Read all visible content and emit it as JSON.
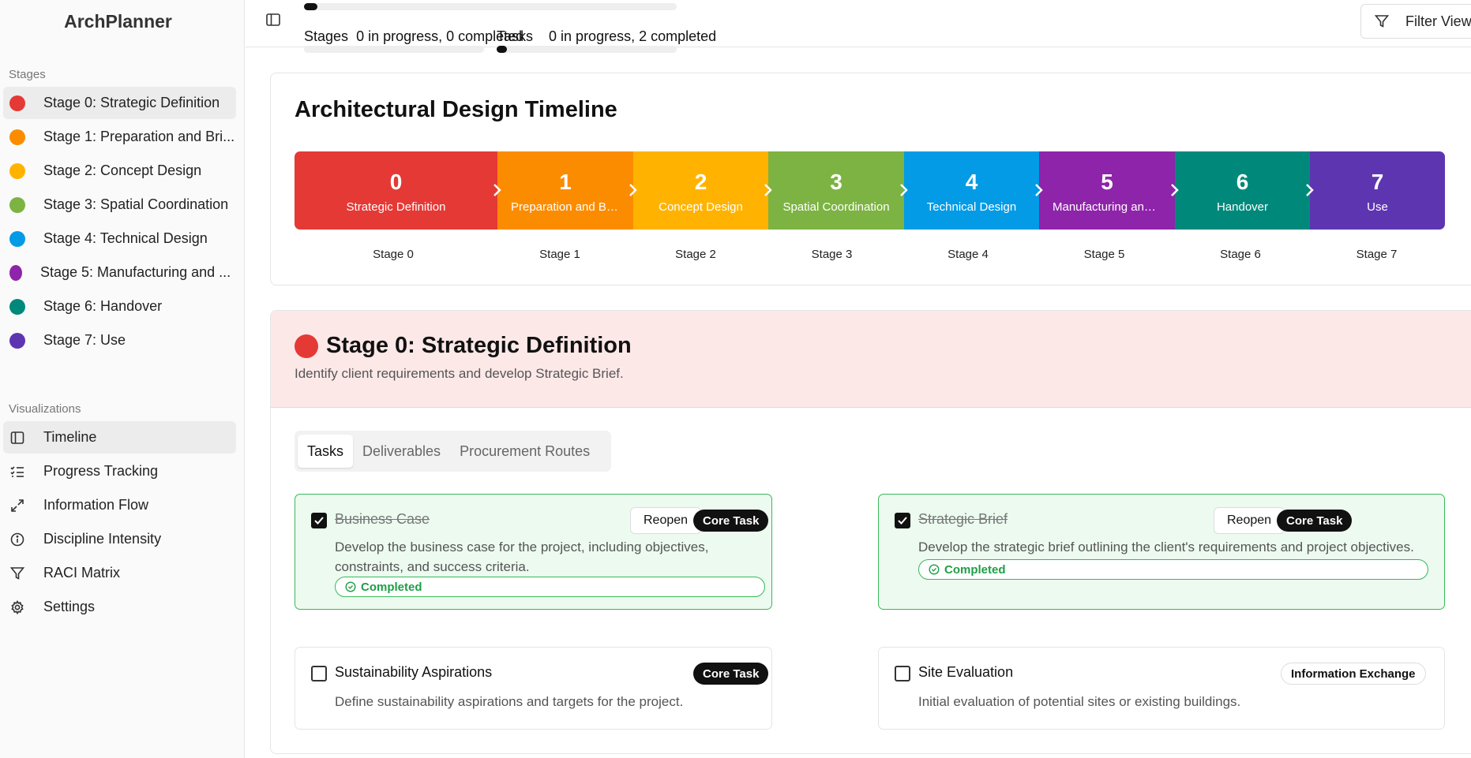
{
  "app": {
    "title": "ArchPlanner"
  },
  "sidebar": {
    "stages_label": "Stages",
    "stages": [
      {
        "label": "Stage 0: Strategic Definition",
        "color": "#e53935",
        "active": true
      },
      {
        "label": "Stage 1: Preparation and Bri...",
        "color": "#fb8c00"
      },
      {
        "label": "Stage 2: Concept Design",
        "color": "#ffb300"
      },
      {
        "label": "Stage 3: Spatial Coordination",
        "color": "#7cb342"
      },
      {
        "label": "Stage 4: Technical Design",
        "color": "#039be5"
      },
      {
        "label": "Stage 5: Manufacturing and ...",
        "color": "#8e24aa"
      },
      {
        "label": "Stage 6: Handover",
        "color": "#00897b"
      },
      {
        "label": "Stage 7: Use",
        "color": "#5e35b1"
      }
    ],
    "viz_label": "Visualizations",
    "visualizations": [
      {
        "label": "Timeline",
        "icon": "panel-icon",
        "active": true
      },
      {
        "label": "Progress Tracking",
        "icon": "list-checks-icon"
      },
      {
        "label": "Information Flow",
        "icon": "expand-arrows-icon"
      },
      {
        "label": "Discipline Intensity",
        "icon": "info-circle-icon"
      },
      {
        "label": "RACI Matrix",
        "icon": "filter-icon"
      },
      {
        "label": "Settings",
        "icon": "gear-icon"
      }
    ]
  },
  "topbar": {
    "stages_label": "Stages",
    "stages_status": "0 in progress, 0 completed",
    "stages_progress": 0.02,
    "tasks_label": "Tasks",
    "tasks_status": "0 in progress, 2 completed",
    "tasks_progress": 0.02,
    "filter_label": "Filter View"
  },
  "timeline": {
    "title": "Architectural Design Timeline",
    "stages": [
      {
        "num": "0",
        "name": "Strategic Definition",
        "label": "Stage 0",
        "color": "#e53935"
      },
      {
        "num": "1",
        "name": "Preparation and Bri...",
        "label": "Stage 1",
        "color": "#fb8c00"
      },
      {
        "num": "2",
        "name": "Concept Design",
        "label": "Stage 2",
        "color": "#ffb300"
      },
      {
        "num": "3",
        "name": "Spatial Coordination",
        "label": "Stage 3",
        "color": "#7cb342"
      },
      {
        "num": "4",
        "name": "Technical Design",
        "label": "Stage 4",
        "color": "#039be5"
      },
      {
        "num": "5",
        "name": "Manufacturing and ...",
        "label": "Stage 5",
        "color": "#8e24aa"
      },
      {
        "num": "6",
        "name": "Handover",
        "label": "Stage 6",
        "color": "#00897b"
      },
      {
        "num": "7",
        "name": "Use",
        "label": "Stage 7",
        "color": "#5e35b1"
      }
    ]
  },
  "stage": {
    "title": "Stage 0: Strategic Definition",
    "description": "Identify client requirements and develop Strategic Brief.",
    "tabs": [
      "Tasks",
      "Deliverables",
      "Procurement Routes"
    ],
    "tasks": [
      {
        "title": "Business Case",
        "description": "Develop the business case for the project, including objectives, constraints, and success criteria.",
        "badge": "Core Task",
        "reopen": "Reopen",
        "status": "Completed"
      },
      {
        "title": "Strategic Brief",
        "description": "Develop the strategic brief outlining the client's requirements and project objectives.",
        "badge": "Core Task",
        "reopen": "Reopen",
        "status": "Completed"
      },
      {
        "title": "Sustainability Aspirations",
        "description": "Define sustainability aspirations and targets for the project.",
        "badge": "Core Task"
      },
      {
        "title": "Site Evaluation",
        "description": "Initial evaluation of potential sites or existing buildings.",
        "badge": "Information Exchange"
      }
    ]
  }
}
